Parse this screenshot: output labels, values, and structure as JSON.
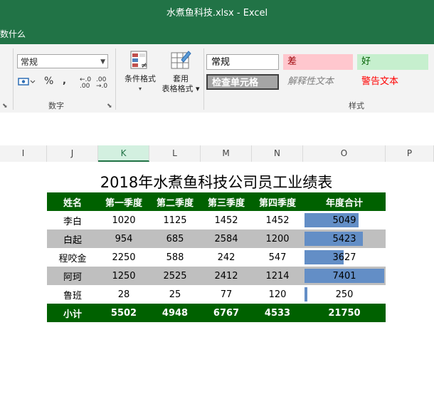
{
  "window": {
    "title": "水煮鱼科技.xlsx  -  Excel"
  },
  "menubar": {
    "tell_me": "数什么"
  },
  "ribbon": {
    "number_format": "常规",
    "number_group_label": "数字",
    "percent_symbol": "%",
    "comma_symbol": ",",
    "increase_decimal": "←.0 .00",
    "decrease_decimal": ".00 →.0",
    "conditional_format": [
      "条件格式",
      ""
    ],
    "format_as_table": [
      "套用",
      "表格格式"
    ],
    "styles": {
      "normal": "常规",
      "bad": "差",
      "good": "好",
      "check_cell": "检查单元格",
      "explanatory": "解释性文本",
      "warning": "警告文本"
    },
    "styles_group_label": "样式"
  },
  "columns": [
    "I",
    "J",
    "K",
    "L",
    "M",
    "N",
    "O",
    "P"
  ],
  "report": {
    "title": "2018年水煮鱼科技公司员工业绩表",
    "headers": [
      "姓名",
      "第一季度",
      "第二季度",
      "第三季度",
      "第四季度",
      "年度合计"
    ],
    "rows": [
      {
        "name": "李白",
        "q1": "1020",
        "q2": "1125",
        "q3": "1452",
        "q4": "1452",
        "total": "5049",
        "bar": 0.682
      },
      {
        "name": "白起",
        "q1": "954",
        "q2": "685",
        "q3": "2584",
        "q4": "1200",
        "total": "5423",
        "bar": 0.733
      },
      {
        "name": "程咬金",
        "q1": "2250",
        "q2": "588",
        "q3": "242",
        "q4": "547",
        "total": "3627",
        "bar": 0.49
      },
      {
        "name": "阿珂",
        "q1": "1250",
        "q2": "2525",
        "q3": "2412",
        "q4": "1214",
        "total": "7401",
        "bar": 1.0
      },
      {
        "name": "鲁班",
        "q1": "28",
        "q2": "25",
        "q3": "77",
        "q4": "120",
        "total": "250",
        "bar": 0.034
      }
    ],
    "subtotal": {
      "label": "小计",
      "q1": "5502",
      "q2": "4948",
      "q3": "6767",
      "q4": "4533",
      "total": "21750"
    }
  }
}
